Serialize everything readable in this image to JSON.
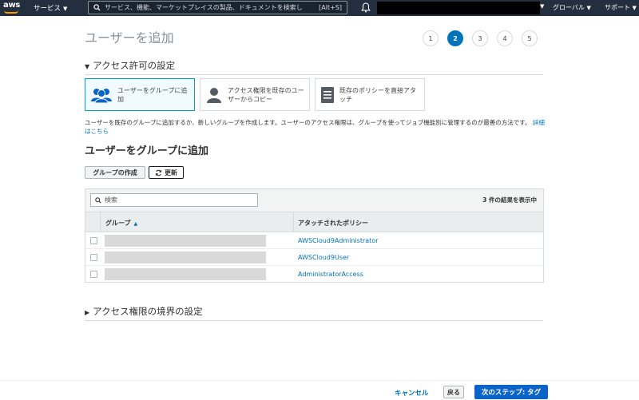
{
  "nav": {
    "logo": "aws",
    "services": "サービス",
    "search_placeholder": "サービス、機能、マーケットプレイスの製品、ドキュメントを検索し",
    "search_shortcut": "[Alt+S]",
    "region": "グローバル",
    "support": "サポート"
  },
  "page": {
    "title": "ユーザーを追加",
    "steps": [
      "1",
      "2",
      "3",
      "4",
      "5"
    ],
    "active_step": "2"
  },
  "permissions": {
    "heading": "アクセス許可の設定",
    "options": [
      {
        "label": "ユーザーをグループに追加",
        "selected": true
      },
      {
        "label": "アクセス権限を既存のユーザーからコピー",
        "selected": false
      },
      {
        "label": "既存のポリシーを直接アタッチ",
        "selected": false
      }
    ],
    "description": "ユーザーを既存のグループに追加するか、新しいグループを作成します。ユーザーのアクセス権限は、グループを使ってジョブ機能別に管理するのが最善の方法です。",
    "details_link": "詳細はこちら"
  },
  "group_section": {
    "title": "ユーザーをグループに追加",
    "create_button": "グループの作成",
    "refresh_button": "更新",
    "search_placeholder": "検索",
    "result_count": "3 件の結果を表示中",
    "columns": {
      "group": "グループ",
      "policy": "アタッチされたポリシー"
    },
    "rows": [
      {
        "group": "",
        "policy": "AWSCloud9Administrator"
      },
      {
        "group": "",
        "policy": "AWSCloud9User"
      },
      {
        "group": "",
        "policy": "AdministratorAccess"
      }
    ]
  },
  "boundary": {
    "heading": "アクセス権限の境界の設定"
  },
  "footer": {
    "cancel": "キャンセル",
    "back": "戻る",
    "next": "次のステップ: タグ"
  },
  "colors": {
    "nav_bg": "#232f3e",
    "accent": "#0073bb",
    "primary_button": "#0a63c9",
    "selected_option_bg": "#f1faff"
  }
}
